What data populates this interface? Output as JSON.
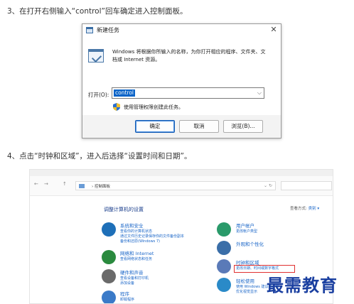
{
  "steps": {
    "step1": "3、在打开右侧输入“control”回车确定进入控制面板。",
    "step2": "4、点击“时钟和区域”，进入后选择“设置时间和日期”。"
  },
  "run_dialog": {
    "title": "新建任务",
    "close_glyph": "✕",
    "description": "Windows 将根据你所输入的名称，为你打开相应的程序、文件夹、文档或 Internet 资源。",
    "open_label": "打开(O):",
    "input_value": "control",
    "admin_text": "使用管理权限创建此任务。",
    "buttons": {
      "ok": "确定",
      "cancel": "取消",
      "browse": "浏览(B)..."
    }
  },
  "control_panel": {
    "nav": {
      "back": "←",
      "forward": "→",
      "up": "↑"
    },
    "address": "› 控制面板",
    "address_tools": "⌄  ↻",
    "heading": "调整计算机的设置",
    "view_by_label": "查看方式:",
    "view_by_value": "类别 ▾",
    "categories_left": [
      {
        "title": "系统和安全",
        "links": [
          "查看你的计算机状态",
          "通过文件历史记录保存你的文件备份副本",
          "备份和还原(Windows 7)"
        ],
        "color": "#1e6fb8"
      },
      {
        "title": "网络和 Internet",
        "links": [
          "查看网络状态和任务"
        ],
        "color": "#2a8a3e"
      },
      {
        "title": "硬件和声音",
        "links": [
          "查看设备和打印机",
          "添加设备"
        ],
        "color": "#6a6a6a"
      },
      {
        "title": "程序",
        "links": [
          "卸载程序"
        ],
        "color": "#3a7ac8"
      }
    ],
    "categories_right": [
      {
        "title": "用户帐户",
        "links": [
          "更改帐户类型"
        ],
        "color": "#2a9a6a"
      },
      {
        "title": "外观和个性化",
        "links": [],
        "color": "#3a6ea8"
      },
      {
        "title": "时钟和区域",
        "links": [
          "更改日期、时间或数字格式"
        ],
        "color": "#5a7ab8"
      },
      {
        "title": "轻松使用",
        "links": [
          "使用 Windows 建议的设置",
          "优化视觉显示"
        ],
        "color": "#2a8ac8"
      }
    ]
  },
  "watermark": "最需教育"
}
